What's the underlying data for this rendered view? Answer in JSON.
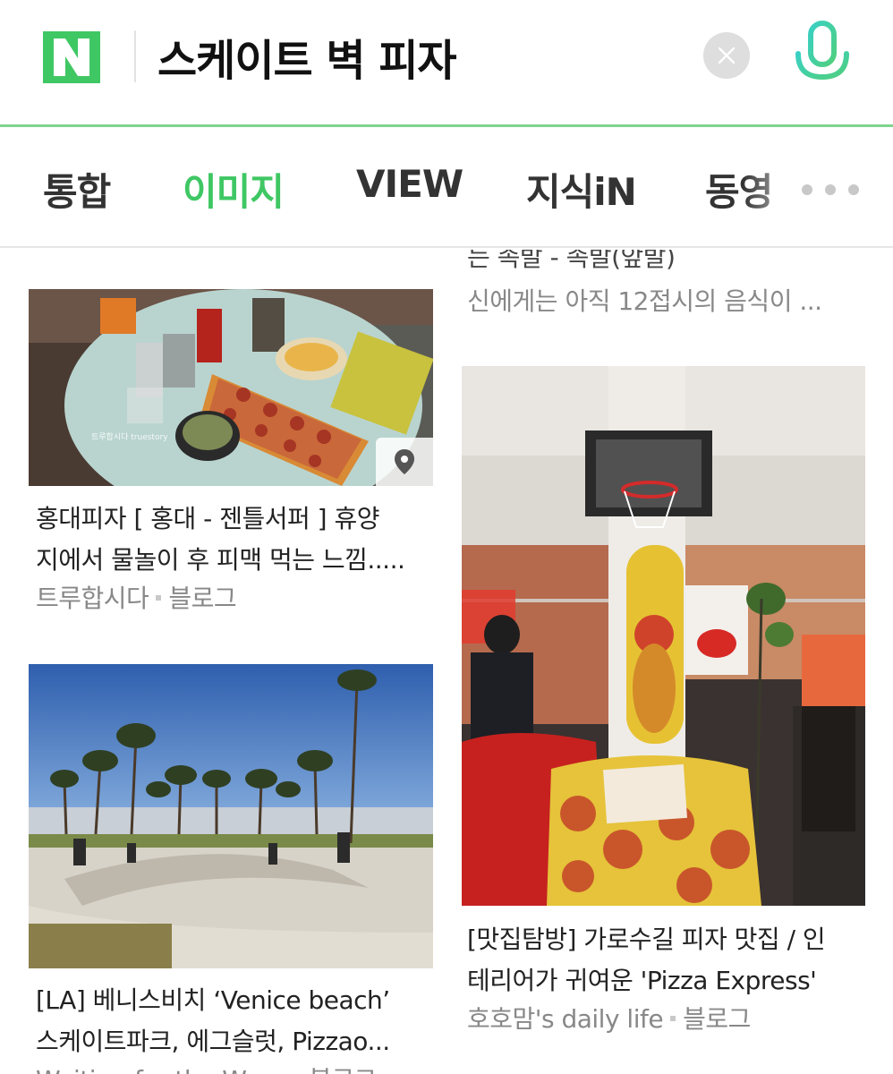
{
  "header": {
    "logo_letter": "N",
    "query": "스케이트 벽 피자",
    "clear_icon": "close-icon",
    "mic_icon": "microphone-icon",
    "accent_color": "#3fc764"
  },
  "tabs": [
    {
      "label": "통합",
      "active": false
    },
    {
      "label": "이미지",
      "active": true
    },
    {
      "label": "VIEW",
      "active": false
    },
    {
      "label": "지식iN",
      "active": false
    },
    {
      "label": "동영",
      "active": false
    }
  ],
  "more_icon": "more-dots-icon",
  "results": {
    "right_top_partial": {
      "title_line1": "는 족발 - 족발(앞발)",
      "snippet": "신에게는 아직 12접시의 음식이 ..."
    },
    "left_1": {
      "title_line1": "홍대피자 [ 홍대 - 젠틀서퍼 ] 휴양",
      "title_line2": "지에서 물놀이 후 피맥 먹는 느낌.....",
      "source": "트루합시다",
      "type": "블로그",
      "watermark": "트루합시다 truestory",
      "badge_icon": "location-pin-icon"
    },
    "left_2": {
      "title_line1": "[LA] 베니스비치 ‘Venice beach’",
      "title_line2": "스케이트파크, 에그슬럿, Pizzao...",
      "source": "Waiting for the Wave",
      "type": "블로그"
    },
    "right_1": {
      "title_line1": "[맛집탐방] 가로수길 피자 맛집 / 인",
      "title_line2": "테리어가 귀여운 'Pizza Express'",
      "source": "호호맘's daily life",
      "type": "블로그"
    }
  }
}
